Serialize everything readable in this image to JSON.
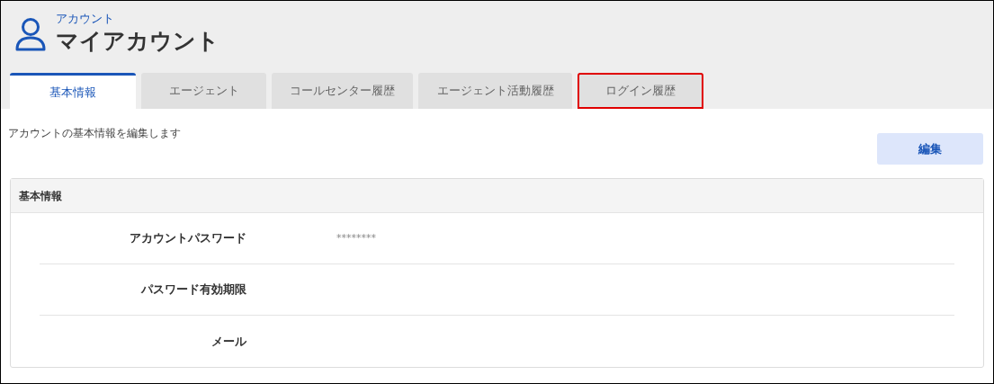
{
  "header": {
    "breadcrumb": "アカウント",
    "title": "マイアカウント"
  },
  "tabs": [
    {
      "label": "基本情報",
      "selected": true,
      "highlighted": false
    },
    {
      "label": "エージェント",
      "selected": false,
      "highlighted": false
    },
    {
      "label": "コールセンター履歴",
      "selected": false,
      "highlighted": false
    },
    {
      "label": "エージェント活動履歴",
      "selected": false,
      "highlighted": false
    },
    {
      "label": "ログイン履歴",
      "selected": false,
      "highlighted": true
    }
  ],
  "description": "アカウントの基本情報を編集します",
  "edit_button": "編集",
  "card": {
    "title": "基本情報",
    "fields": [
      {
        "label": "アカウントパスワード",
        "value": "********"
      },
      {
        "label": "パスワード有効期限"
      },
      {
        "label": "メール"
      }
    ]
  }
}
